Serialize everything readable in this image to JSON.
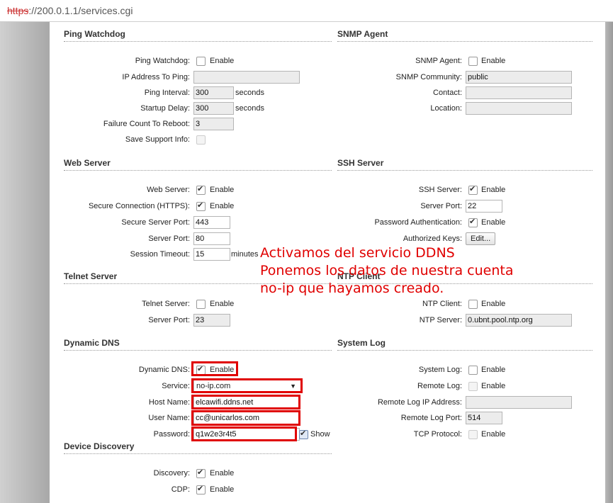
{
  "browser": {
    "url_scheme": "https",
    "url_rest": "://200.0.1.1/services.cgi"
  },
  "ping": {
    "title": "Ping Watchdog",
    "enabled_label": "Ping Watchdog:",
    "enable_text": "Enable",
    "ip_label": "IP Address To Ping:",
    "ip_value": "",
    "interval_label": "Ping Interval:",
    "interval_value": "300",
    "interval_unit": "seconds",
    "startup_label": "Startup Delay:",
    "startup_value": "300",
    "startup_unit": "seconds",
    "failure_label": "Failure Count To Reboot:",
    "failure_value": "3",
    "support_label": "Save Support Info:"
  },
  "snmp": {
    "title": "SNMP Agent",
    "agent_label": "SNMP Agent:",
    "enable_text": "Enable",
    "community_label": "SNMP Community:",
    "community_value": "public",
    "contact_label": "Contact:",
    "contact_value": "",
    "location_label": "Location:",
    "location_value": ""
  },
  "web": {
    "title": "Web Server",
    "server_label": "Web Server:",
    "enable_text": "Enable",
    "https_label": "Secure Connection (HTTPS):",
    "https_enable_text": "Enable",
    "secure_port_label": "Secure Server Port:",
    "secure_port_value": "443",
    "port_label": "Server Port:",
    "port_value": "80",
    "timeout_label": "Session Timeout:",
    "timeout_value": "15",
    "timeout_unit": "minutes"
  },
  "ssh": {
    "title": "SSH Server",
    "server_label": "SSH Server:",
    "enable_text": "Enable",
    "port_label": "Server Port:",
    "port_value": "22",
    "pwauth_label": "Password Authentication:",
    "pwauth_enable_text": "Enable",
    "keys_label": "Authorized Keys:",
    "edit_button": "Edit..."
  },
  "telnet": {
    "title": "Telnet Server",
    "server_label": "Telnet Server:",
    "enable_text": "Enable",
    "port_label": "Server Port:",
    "port_value": "23"
  },
  "ntp": {
    "title": "NTP Client",
    "client_label": "NTP Client:",
    "enable_text": "Enable",
    "server_label": "NTP Server:",
    "server_value": "0.ubnt.pool.ntp.org"
  },
  "ddns": {
    "title": "Dynamic DNS",
    "enabled_label": "Dynamic DNS:",
    "enable_text": "Enable",
    "service_label": "Service:",
    "service_value": "no-ip.com",
    "host_label": "Host Name:",
    "host_value": "elcawifi.ddns.net",
    "user_label": "User Name:",
    "user_value": "cc@unicarlos.com",
    "password_label": "Password:",
    "password_value": "q1w2e3r4t5",
    "show_text": "Show"
  },
  "syslog": {
    "title": "System Log",
    "syslog_label": "System Log:",
    "enable_text": "Enable",
    "remote_label": "Remote Log:",
    "remote_enable_text": "Enable",
    "remote_ip_label": "Remote Log IP Address:",
    "remote_ip_value": "",
    "remote_port_label": "Remote Log Port:",
    "remote_port_value": "514",
    "tcp_label": "TCP Protocol:",
    "tcp_enable_text": "Enable"
  },
  "discovery": {
    "title": "Device Discovery",
    "discovery_label": "Discovery:",
    "enable_text": "Enable",
    "cdp_label": "CDP:",
    "cdp_enable_text": "Enable"
  },
  "annotation": {
    "line1": "Activamos del servicio DDNS",
    "line2": "Ponemos los datos de nuestra cuenta",
    "line3": "no-ip que hayamos creado."
  },
  "colors": {
    "highlight": "#e00000",
    "panel_bg": "#ffffff",
    "side_bg": "#b4b4b4"
  }
}
